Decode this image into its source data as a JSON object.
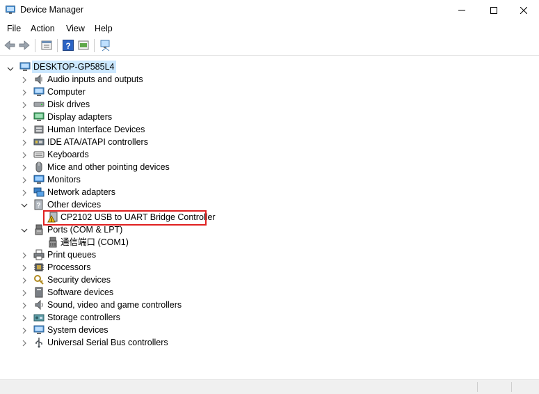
{
  "window": {
    "title": "Device Manager"
  },
  "menu": [
    "File",
    "Action",
    "View",
    "Help"
  ],
  "toolbar": {
    "buttons": [
      "back-icon",
      "forward-icon",
      "properties-icon",
      "help-icon",
      "update-driver-icon",
      "scan-hardware-icon"
    ]
  },
  "tree": {
    "root": "DESKTOP-GP585L4",
    "categories": [
      {
        "label": "Audio inputs and outputs",
        "icon": "speaker-icon",
        "expanded": false
      },
      {
        "label": "Computer",
        "icon": "computer-icon",
        "expanded": false
      },
      {
        "label": "Disk drives",
        "icon": "disk-drive-icon",
        "expanded": false
      },
      {
        "label": "Display adapters",
        "icon": "display-adapter-icon",
        "expanded": false
      },
      {
        "label": "Human Interface Devices",
        "icon": "hid-icon",
        "expanded": false
      },
      {
        "label": "IDE ATA/ATAPI controllers",
        "icon": "ide-controller-icon",
        "expanded": false
      },
      {
        "label": "Keyboards",
        "icon": "keyboard-icon",
        "expanded": false
      },
      {
        "label": "Mice and other pointing devices",
        "icon": "mouse-icon",
        "expanded": false
      },
      {
        "label": "Monitors",
        "icon": "monitor-icon",
        "expanded": false
      },
      {
        "label": "Network adapters",
        "icon": "network-adapter-icon",
        "expanded": false
      },
      {
        "label": "Other devices",
        "icon": "unknown-device-icon",
        "expanded": true
      },
      {
        "label": "CP2102 USB to UART Bridge Controller",
        "icon": "warning-device-icon",
        "child": true
      },
      {
        "label": "Ports (COM & LPT)",
        "icon": "port-icon",
        "expanded": true
      },
      {
        "label": "通信端口 (COM1)",
        "icon": "com-port-icon",
        "child": true
      },
      {
        "label": "Print queues",
        "icon": "printer-icon",
        "expanded": false
      },
      {
        "label": "Processors",
        "icon": "processor-icon",
        "expanded": false
      },
      {
        "label": "Security devices",
        "icon": "security-icon",
        "expanded": false
      },
      {
        "label": "Software devices",
        "icon": "software-device-icon",
        "expanded": false
      },
      {
        "label": "Sound, video and game controllers",
        "icon": "sound-icon",
        "expanded": false
      },
      {
        "label": "Storage controllers",
        "icon": "storage-icon",
        "expanded": false
      },
      {
        "label": "System devices",
        "icon": "system-icon",
        "expanded": false
      },
      {
        "label": "Universal Serial Bus controllers",
        "icon": "usb-icon",
        "expanded": false
      }
    ]
  },
  "colors": {
    "selection": "#cce8ff",
    "highlight_box": "#e02020"
  }
}
